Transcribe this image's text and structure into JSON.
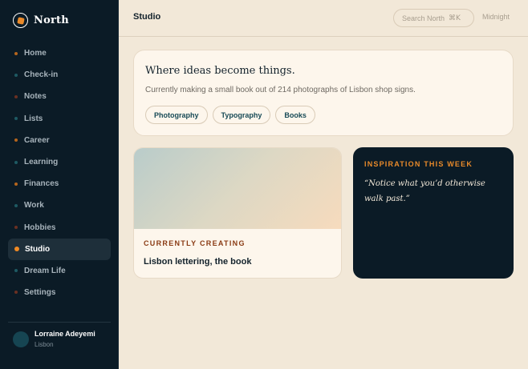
{
  "brand": {
    "name": "North"
  },
  "nav": {
    "items": [
      {
        "label": "Home",
        "dot": "#b5651d"
      },
      {
        "label": "Check-in",
        "dot": "#1e5a63"
      },
      {
        "label": "Notes",
        "dot": "#6a3022"
      },
      {
        "label": "Lists",
        "dot": "#1e5a63"
      },
      {
        "label": "Career",
        "dot": "#b5651d"
      },
      {
        "label": "Learning",
        "dot": "#1e5a63"
      },
      {
        "label": "Finances",
        "dot": "#b5651d"
      },
      {
        "label": "Work",
        "dot": "#1e5a63"
      },
      {
        "label": "Hobbies",
        "dot": "#6a3022"
      },
      {
        "label": "Studio",
        "dot": "#f08a24",
        "active": true
      },
      {
        "label": "Dream Life",
        "dot": "#1e5a63"
      },
      {
        "label": "Settings",
        "dot": "#6a3022"
      }
    ]
  },
  "profile": {
    "name": "Lorraine Adeyemi",
    "location": "Lisbon"
  },
  "topbar": {
    "title": "Studio",
    "search_placeholder": "Search North",
    "search_shortcut": "⌘K",
    "theme_label": "Midnight"
  },
  "hero": {
    "title": "Where ideas become things.",
    "subtitle": "Currently making a small book out of 214 photographs of Lisbon shop signs.",
    "chips": [
      "Photography",
      "Typography",
      "Books"
    ]
  },
  "current": {
    "kicker": "CURRENTLY CREATING",
    "title": "Lisbon lettering, the book"
  },
  "inspiration": {
    "kicker": "INSPIRATION THIS WEEK",
    "quote": "“Notice what you’d otherwise walk past.”"
  },
  "colors": {
    "accent": "#e98a2a",
    "sidebar_bg": "#0b1b26",
    "page_bg": "#f2e8d8",
    "card_bg": "#fdf6ec",
    "chip_text": "#174a56",
    "kicker_rust": "#8a3b14"
  }
}
